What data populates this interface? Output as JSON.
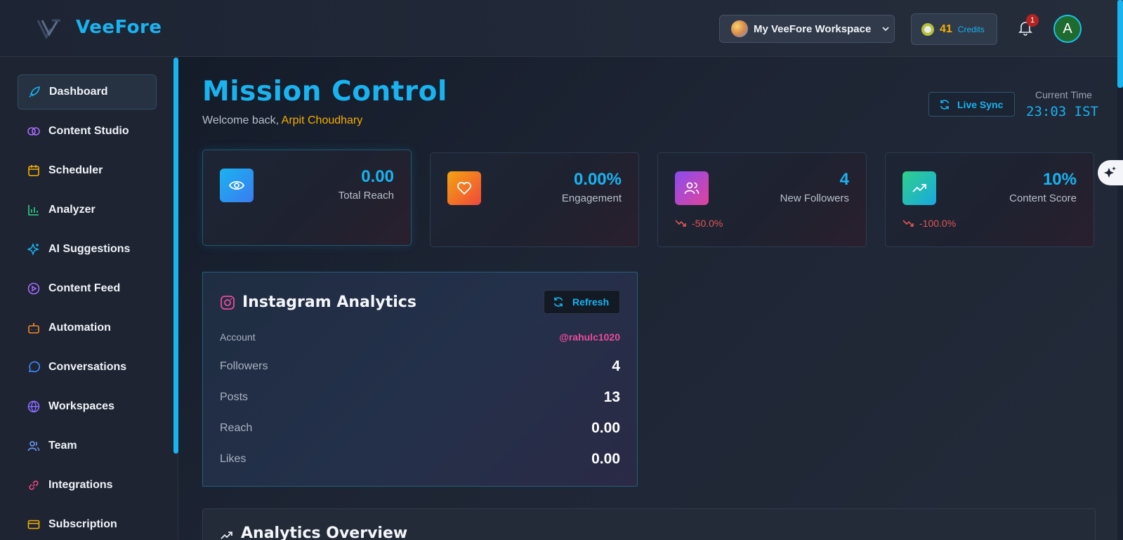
{
  "app": {
    "name": "VeeFore",
    "workspace_label": "My VeeFore Workspace",
    "credits_value": "41",
    "credits_label": "Credits",
    "notification_count": "1",
    "avatar_initial": "A"
  },
  "sidebar": {
    "items": [
      {
        "label": "Dashboard",
        "icon": "rocket-icon",
        "active": true
      },
      {
        "label": "Content Studio",
        "icon": "brain-icon"
      },
      {
        "label": "Scheduler",
        "icon": "calendar-icon"
      },
      {
        "label": "Analyzer",
        "icon": "bar-chart-icon"
      },
      {
        "label": "AI Suggestions",
        "icon": "sparkles-icon"
      },
      {
        "label": "Content Feed",
        "icon": "play-circle-icon"
      },
      {
        "label": "Automation",
        "icon": "bot-icon"
      },
      {
        "label": "Conversations",
        "icon": "message-circle-icon"
      },
      {
        "label": "Workspaces",
        "icon": "globe-icon"
      },
      {
        "label": "Team",
        "icon": "users-icon"
      },
      {
        "label": "Integrations",
        "icon": "link-icon"
      },
      {
        "label": "Subscription",
        "icon": "credit-card-icon"
      }
    ]
  },
  "main": {
    "title": "Mission Control",
    "welcome_prefix": "Welcome back,",
    "user_name": "Arpit Choudhary",
    "live_sync_label": "Live Sync",
    "current_time_label": "Current Time",
    "current_time_value": "23:03 IST"
  },
  "stats": [
    {
      "value": "0.00",
      "label": "Total Reach",
      "icon": "eye-icon",
      "trend": ""
    },
    {
      "value": "0.00%",
      "label": "Engagement",
      "icon": "heart-icon",
      "trend": ""
    },
    {
      "value": "4",
      "label": "New Followers",
      "icon": "users-icon",
      "trend": "-50.0%"
    },
    {
      "value": "10%",
      "label": "Content Score",
      "icon": "trending-up-icon",
      "trend": "-100.0%"
    }
  ],
  "instagram": {
    "title": "Instagram Analytics",
    "refresh_label": "Refresh",
    "account_label": "Account",
    "account_value": "@rahulc1020",
    "rows": [
      {
        "label": "Followers",
        "value": "4"
      },
      {
        "label": "Posts",
        "value": "13"
      },
      {
        "label": "Reach",
        "value": "0.00"
      },
      {
        "label": "Likes",
        "value": "0.00"
      }
    ]
  },
  "overview": {
    "title": "Analytics Overview"
  },
  "colors": {
    "accent": "#19b3f0",
    "highlight": "#f4b000",
    "negative": "#e05757",
    "instagram_pink": "#ea4c9c"
  }
}
